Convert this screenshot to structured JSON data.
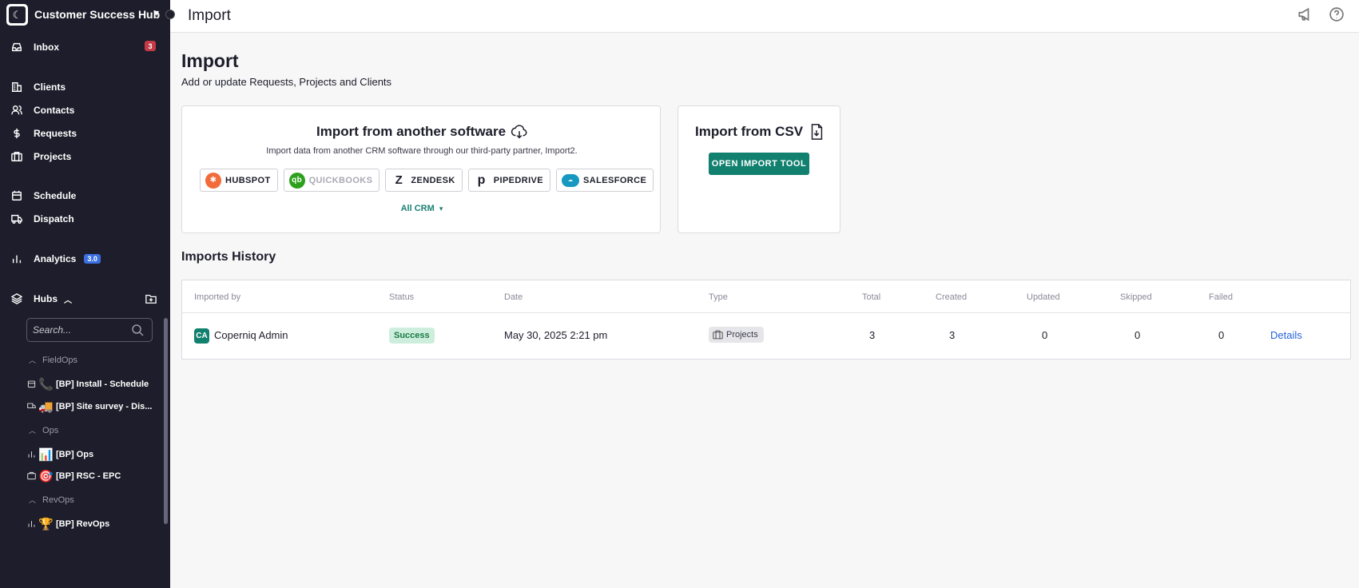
{
  "sidebar": {
    "workspace_name": "Customer Success Hub",
    "nav": [
      {
        "label": "Inbox",
        "icon": "inbox-icon",
        "badge": "3"
      },
      {
        "label": "Clients",
        "icon": "building-icon"
      },
      {
        "label": "Contacts",
        "icon": "users-icon"
      },
      {
        "label": "Requests",
        "icon": "dollar-icon"
      },
      {
        "label": "Projects",
        "icon": "briefcase-icon"
      },
      {
        "label": "Schedule",
        "icon": "calendar-icon"
      },
      {
        "label": "Dispatch",
        "icon": "truck-icon"
      },
      {
        "label": "Analytics",
        "icon": "bar-chart-icon",
        "badge": "3.0"
      },
      {
        "label": "Hubs",
        "icon": "layers-icon"
      }
    ],
    "search_placeholder": "Search...",
    "groups": [
      {
        "label": "FieldOps",
        "hubs": [
          {
            "label": "[BP] Install - Schedule",
            "emoji": "📞"
          },
          {
            "label": "[BP] Site survey - Dis...",
            "emoji": "🚚"
          }
        ]
      },
      {
        "label": "Ops",
        "hubs": [
          {
            "label": "[BP] Ops",
            "emoji": "📊"
          },
          {
            "label": "[BP] RSC - EPC",
            "emoji": "🎯"
          }
        ]
      },
      {
        "label": "RevOps",
        "hubs": [
          {
            "label": "[BP] RevOps",
            "emoji": "🏆"
          }
        ]
      }
    ]
  },
  "topbar": {
    "title": "Import"
  },
  "main": {
    "title": "Import",
    "subtitle": "Add or update Requests, Projects and Clients",
    "software_card": {
      "title": "Import from another software",
      "description": "Import data from another CRM software through our third-party partner, Import2.",
      "crms": [
        "HUBSPOT",
        "QUICKBOOKS",
        "ZENDESK",
        "PIPEDRIVE",
        "SALESFORCE"
      ],
      "all_crm": "All CRM"
    },
    "csv_card": {
      "title": "Import from CSV",
      "button": "OPEN IMPORT TOOL"
    },
    "history": {
      "title": "Imports History",
      "columns": [
        "Imported by",
        "Status",
        "Date",
        "Type",
        "Total",
        "Created",
        "Updated",
        "Skipped",
        "Failed"
      ],
      "rows": [
        {
          "initials": "CA",
          "imported_by": "Coperniq Admin",
          "status": "Success",
          "date": "May 30, 2025 2:21 pm",
          "type": "Projects",
          "total": "3",
          "created": "3",
          "updated": "0",
          "skipped": "0",
          "failed": "0",
          "action": "Details"
        }
      ]
    }
  },
  "colors": {
    "sidebar_bg": "#1d1d2b",
    "accent_green": "#11806f",
    "badge_red": "#c53a47",
    "badge_blue": "#3b6fe0",
    "link_blue": "#2563d9"
  }
}
